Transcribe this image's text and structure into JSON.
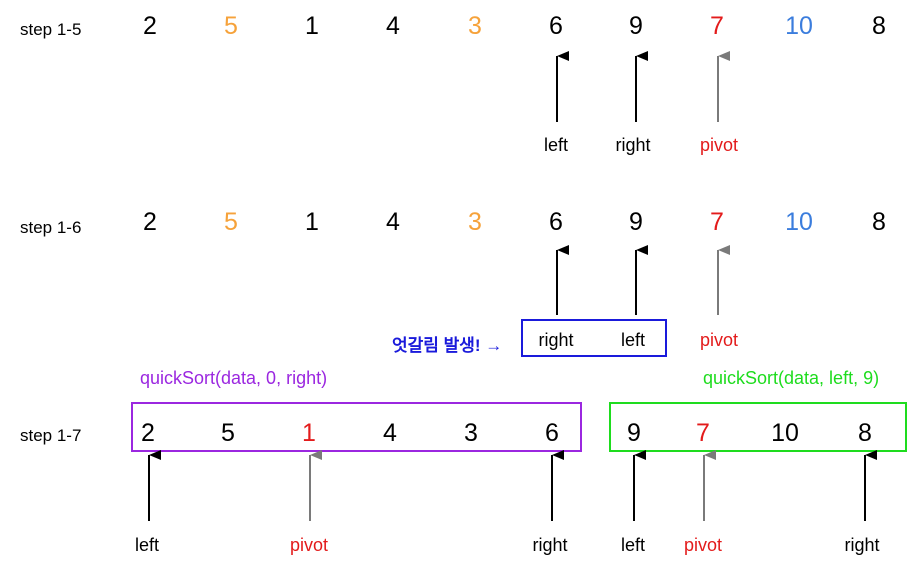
{
  "colors": {
    "black": "#000000",
    "orange": "#f6a23a",
    "red": "#e31b1b",
    "blue": "#3b7ddd",
    "purple": "#9b27e0",
    "green": "#1edc1e",
    "warn_blue": "#1a1adb",
    "grey_arrow": "#7a7a7a"
  },
  "steps": {
    "s15": {
      "label": "step 1-5",
      "numbers": [
        {
          "v": "2",
          "c": "black"
        },
        {
          "v": "5",
          "c": "orange"
        },
        {
          "v": "1",
          "c": "black"
        },
        {
          "v": "4",
          "c": "black"
        },
        {
          "v": "3",
          "c": "orange"
        },
        {
          "v": "6",
          "c": "black"
        },
        {
          "v": "9",
          "c": "black"
        },
        {
          "v": "7",
          "c": "red"
        },
        {
          "v": "10",
          "c": "blue"
        },
        {
          "v": "8",
          "c": "black"
        }
      ],
      "pointers": {
        "left": "left",
        "right": "right",
        "pivot": "pivot"
      }
    },
    "s16": {
      "label": "step 1-6",
      "numbers": [
        {
          "v": "2",
          "c": "black"
        },
        {
          "v": "5",
          "c": "orange"
        },
        {
          "v": "1",
          "c": "black"
        },
        {
          "v": "4",
          "c": "black"
        },
        {
          "v": "3",
          "c": "orange"
        },
        {
          "v": "6",
          "c": "black"
        },
        {
          "v": "9",
          "c": "black"
        },
        {
          "v": "7",
          "c": "red"
        },
        {
          "v": "10",
          "c": "blue"
        },
        {
          "v": "8",
          "c": "black"
        }
      ],
      "warning": "엇갈림 발생! →",
      "pointers": {
        "right": "right",
        "left": "left",
        "pivot": "pivot"
      }
    },
    "s17": {
      "label": "step 1-7",
      "left_call": "quickSort(data, 0, right)",
      "right_call": "quickSort(data, left, 9)",
      "left_numbers": [
        {
          "v": "2",
          "c": "black"
        },
        {
          "v": "5",
          "c": "black"
        },
        {
          "v": "1",
          "c": "red"
        },
        {
          "v": "4",
          "c": "black"
        },
        {
          "v": "3",
          "c": "black"
        },
        {
          "v": "6",
          "c": "black"
        }
      ],
      "right_numbers": [
        {
          "v": "9",
          "c": "black"
        },
        {
          "v": "7",
          "c": "red"
        },
        {
          "v": "10",
          "c": "black"
        },
        {
          "v": "8",
          "c": "black"
        }
      ],
      "left_pointers": {
        "left": "left",
        "pivot": "pivot",
        "right": "right"
      },
      "right_pointers": {
        "left": "left",
        "pivot": "pivot",
        "right": "right"
      }
    }
  }
}
